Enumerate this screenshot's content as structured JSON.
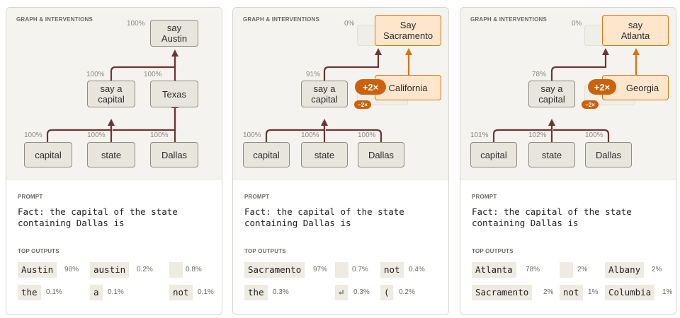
{
  "cards": [
    {
      "graph_title": "GRAPH & INTERVENTIONS",
      "prompt_label": "PROMPT",
      "prompt_lines": [
        "Fact: the capital of the state",
        "containing Dallas is"
      ],
      "top_outputs_label": "TOP OUTPUTS",
      "nodes": {
        "capital": "capital",
        "state": "state",
        "dallas": "Dallas",
        "say_capital_1": "say a",
        "say_capital_2": "capital",
        "texas": "Texas",
        "say_austin_1": "say",
        "say_austin_2": "Austin"
      },
      "percents": {
        "capital": "100%",
        "state": "100%",
        "dallas": "100%",
        "say_capital": "100%",
        "texas": "100%",
        "say_austin": "100%"
      },
      "outputs": [
        {
          "token": "Austin",
          "prob": "98%"
        },
        {
          "token": "austin",
          "prob": "0.2%"
        },
        {
          "token": "",
          "prob": "0.8%"
        },
        {
          "token": "the",
          "prob": "0.1%"
        },
        {
          "token": "a",
          "prob": "0.1%"
        },
        {
          "token": "not",
          "prob": "0.1%"
        }
      ]
    },
    {
      "graph_title": "GRAPH & INTERVENTIONS",
      "prompt_label": "PROMPT",
      "prompt_lines": [
        "Fact: the capital of the state",
        "containing Dallas is"
      ],
      "top_outputs_label": "TOP OUTPUTS",
      "nodes": {
        "capital": "capital",
        "state": "state",
        "dallas": "Dallas",
        "say_capital_1": "say a",
        "say_capital_2": "capital",
        "intervention": "California",
        "say_out_1": "Say",
        "say_out_2": "Sacramento"
      },
      "percents": {
        "capital": "100%",
        "state": "100%",
        "dallas": "100%",
        "say_capital": "91%",
        "ghost": "0%"
      },
      "pill_big": "+2×",
      "pill_small": "−2×",
      "outputs": [
        {
          "token": "Sacramento",
          "prob": "97%"
        },
        {
          "token": "",
          "prob": "0.7%"
        },
        {
          "token": "not",
          "prob": "0.4%"
        },
        {
          "token": "the",
          "prob": "0.3%"
        },
        {
          "token": "⏎",
          "prob": "0.3%"
        },
        {
          "token": "(",
          "prob": "0.2%"
        }
      ]
    },
    {
      "graph_title": "GRAPH & INTERVENTIONS",
      "prompt_label": "PROMPT",
      "prompt_lines": [
        "Fact: the capital of the state",
        "containing Dallas is"
      ],
      "top_outputs_label": "TOP OUTPUTS",
      "nodes": {
        "capital": "capital",
        "state": "state",
        "dallas": "Dallas",
        "say_capital_1": "say a",
        "say_capital_2": "capital",
        "intervention": "Georgia",
        "say_out_1": "say",
        "say_out_2": "Atlanta"
      },
      "percents": {
        "capital": "101%",
        "state": "102%",
        "dallas": "100%",
        "say_capital": "78%",
        "ghost": "0%"
      },
      "pill_big": "+2×",
      "pill_small": "−2×",
      "outputs": [
        {
          "token": "Atlanta",
          "prob": "78%"
        },
        {
          "token": "",
          "prob": "2%"
        },
        {
          "token": "Albany",
          "prob": "2%"
        },
        {
          "token": "Sacramento",
          "prob": "2%"
        },
        {
          "token": "not",
          "prob": "1%"
        },
        {
          "token": "Columbia",
          "prob": "1%"
        }
      ]
    }
  ],
  "colors": {
    "edge": "#6e3434",
    "intervention": "#d7740d",
    "node_fill": "#e8e5dc",
    "accent_fill": "#fde6cc"
  }
}
